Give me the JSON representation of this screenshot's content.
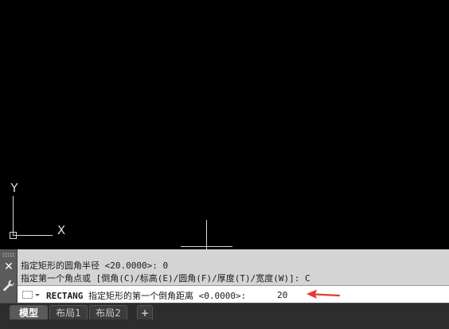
{
  "ucs": {
    "y_label": "Y",
    "x_label": "X"
  },
  "command_line": {
    "history": [
      "指定矩形的圆角半径 <20.0000>: 0",
      "指定第一个角点或 [倒角(C)/标高(E)/圆角(F)/厚度(T)/宽度(W)]: C"
    ],
    "command_name": "RECTANG",
    "prompt": "指定矩形的第一个倒角距离 <0.0000>:",
    "input_value": "20"
  },
  "tabs": [
    {
      "label": "模型",
      "active": true
    },
    {
      "label": "布局1",
      "active": false
    },
    {
      "label": "布局2",
      "active": false
    }
  ],
  "add_tab_label": "+",
  "colors": {
    "canvas": "#000000",
    "annotation_arrow": "#e53935"
  }
}
